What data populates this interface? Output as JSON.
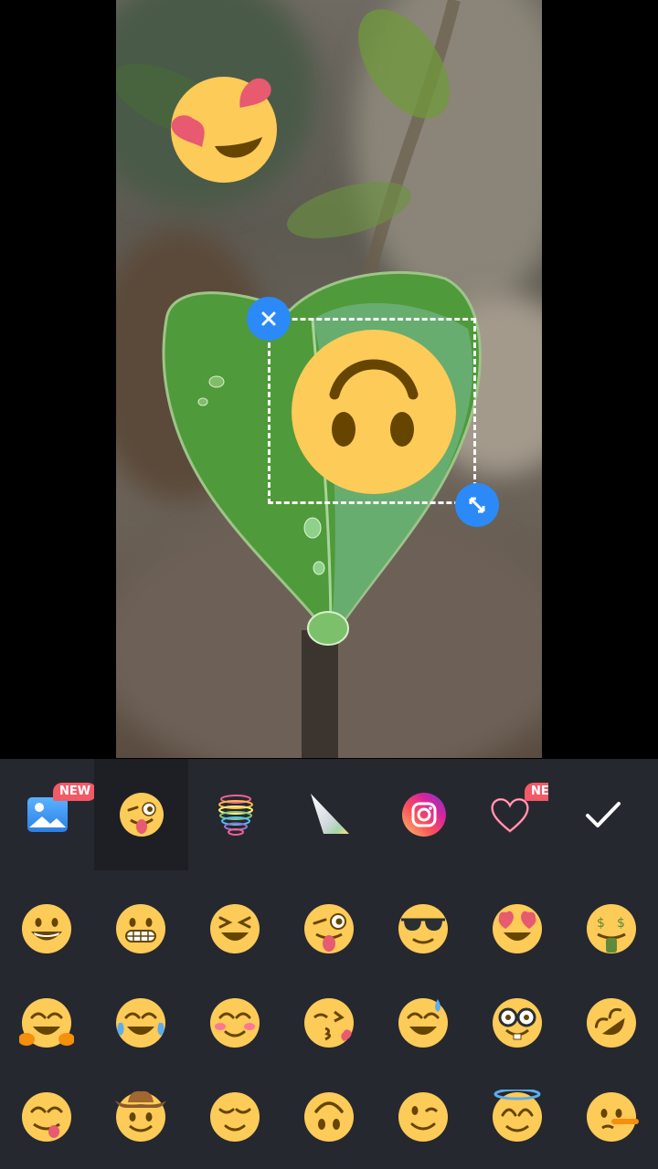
{
  "toolbar": {
    "tabs": [
      {
        "name": "gallery",
        "badge": "NEW"
      },
      {
        "name": "emoji"
      },
      {
        "name": "rainbow-spring"
      },
      {
        "name": "light-prism"
      },
      {
        "name": "instagram"
      },
      {
        "name": "neon-heart",
        "badge": "NEW"
      }
    ],
    "active_tab": "emoji"
  },
  "stickers": [
    {
      "name": "heart-eyes-face"
    },
    {
      "name": "upside-down-face",
      "selected": true
    }
  ],
  "emoji_grid": [
    [
      "grinning-face",
      "grimacing-face",
      "squinting-face",
      "winking-tongue-face",
      "sunglasses-face",
      "heart-eyes-face",
      "money-mouth-face"
    ],
    [
      "hugging-face",
      "tears-of-joy-face",
      "smiling-blush-face",
      "kissing-heart-face",
      "sweat-smile-face",
      "nerd-face",
      "rofl-face"
    ],
    [
      "yum-face",
      "cowboy-face",
      "relieved-face",
      "upside-down-face",
      "wink-face",
      "halo-face",
      "lying-face"
    ]
  ],
  "colors": {
    "accent": "#2b8af7",
    "badge": "#f25a67",
    "panel": "#262830",
    "emoji": "#fdcb58"
  }
}
